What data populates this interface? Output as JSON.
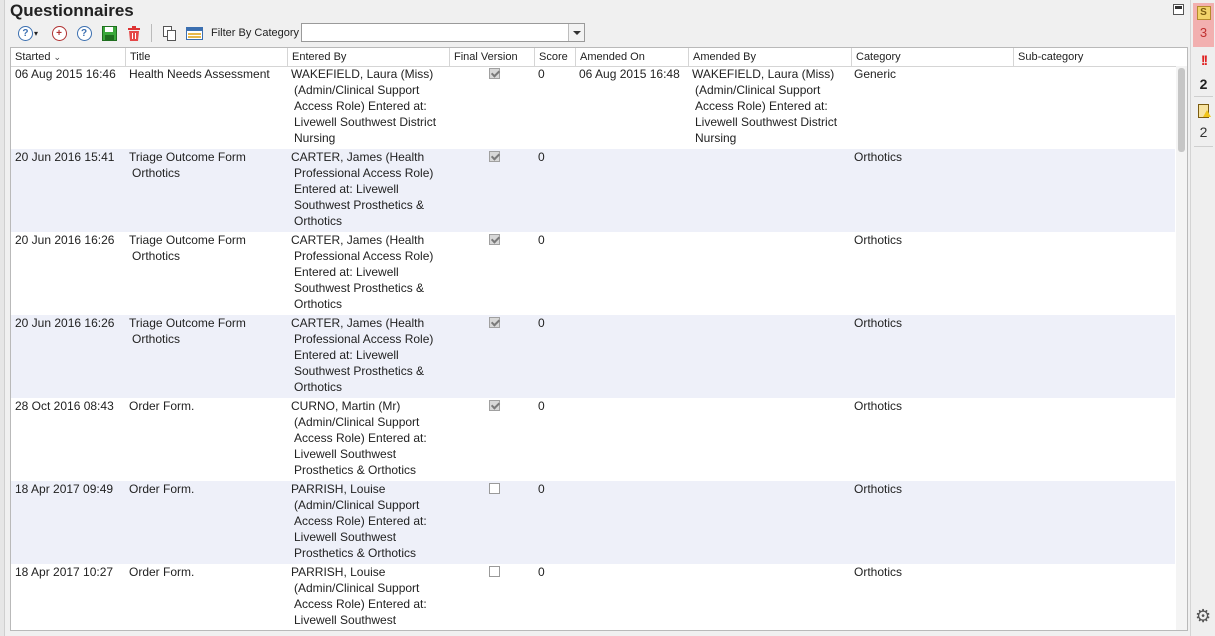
{
  "panel": {
    "title": "Questionnaires"
  },
  "toolbar": {
    "filter_label": "Filter By Category",
    "filter_value": "",
    "icons": [
      "help-dropdown-icon",
      "add-questionnaire-icon",
      "help-icon",
      "save-icon",
      "delete-icon",
      "copy-icon",
      "category-table-icon"
    ]
  },
  "colors": {
    "row_alt": "#eef0f9",
    "alert_bg": "#f2b0b0",
    "alert_red": "#e02020"
  },
  "columns": [
    {
      "label": "Started",
      "sorted": true
    },
    {
      "label": "Title"
    },
    {
      "label": "Entered By"
    },
    {
      "label": "Final Version"
    },
    {
      "label": "Score"
    },
    {
      "label": "Amended On"
    },
    {
      "label": "Amended By"
    },
    {
      "label": "Category"
    },
    {
      "label": "Sub-category"
    }
  ],
  "rows": [
    {
      "started": "06 Aug 2015 16:46",
      "title": [
        "Health Needs Assessment"
      ],
      "entered_by": [
        "WAKEFIELD, Laura (Miss)",
        "(Admin/Clinical Support",
        "Access Role) Entered at:",
        "Livewell Southwest District",
        "Nursing"
      ],
      "final": true,
      "score": "0",
      "amended_on": "06 Aug 2015 16:48",
      "amended_by": [
        "WAKEFIELD, Laura (Miss)",
        "(Admin/Clinical Support",
        "Access Role) Entered at:",
        "Livewell Southwest District",
        "Nursing"
      ],
      "category": "Generic",
      "subcategory": ""
    },
    {
      "started": "20 Jun 2016 15:41",
      "title": [
        "Triage Outcome Form",
        "Orthotics"
      ],
      "entered_by": [
        "CARTER, James (Health",
        "Professional Access Role)",
        "Entered at: Livewell",
        "Southwest Prosthetics &",
        "Orthotics"
      ],
      "final": true,
      "score": "0",
      "amended_on": "",
      "amended_by": [],
      "category": "Orthotics",
      "subcategory": ""
    },
    {
      "started": "20 Jun 2016 16:26",
      "title": [
        "Triage Outcome Form",
        "Orthotics"
      ],
      "entered_by": [
        "CARTER, James (Health",
        "Professional Access Role)",
        "Entered at: Livewell",
        "Southwest Prosthetics &",
        "Orthotics"
      ],
      "final": true,
      "score": "0",
      "amended_on": "",
      "amended_by": [],
      "category": "Orthotics",
      "subcategory": ""
    },
    {
      "started": "20 Jun 2016 16:26",
      "title": [
        "Triage Outcome Form",
        "Orthotics"
      ],
      "entered_by": [
        "CARTER, James (Health",
        "Professional Access Role)",
        "Entered at: Livewell",
        "Southwest Prosthetics &",
        "Orthotics"
      ],
      "final": true,
      "score": "0",
      "amended_on": "",
      "amended_by": [],
      "category": "Orthotics",
      "subcategory": ""
    },
    {
      "started": "28 Oct 2016 08:43",
      "title": [
        "Order Form."
      ],
      "entered_by": [
        "CURNO, Martin (Mr)",
        "(Admin/Clinical Support",
        "Access Role) Entered at:",
        "Livewell Southwest",
        "Prosthetics & Orthotics"
      ],
      "final": true,
      "score": "0",
      "amended_on": "",
      "amended_by": [],
      "category": "Orthotics",
      "subcategory": ""
    },
    {
      "started": "18 Apr 2017 09:49",
      "title": [
        "Order Form."
      ],
      "entered_by": [
        "PARRISH, Louise",
        "(Admin/Clinical Support",
        "Access Role) Entered at:",
        "Livewell Southwest",
        "Prosthetics & Orthotics"
      ],
      "final": false,
      "score": "0",
      "amended_on": "",
      "amended_by": [],
      "category": "Orthotics",
      "subcategory": ""
    },
    {
      "started": "18 Apr 2017 10:27",
      "title": [
        "Order Form."
      ],
      "entered_by": [
        "PARRISH, Louise",
        "(Admin/Clinical Support",
        "Access Role) Entered at:",
        "Livewell Southwest"
      ],
      "final": false,
      "score": "0",
      "amended_on": "",
      "amended_by": [],
      "category": "Orthotics",
      "subcategory": ""
    }
  ],
  "sidebar": {
    "alert_count": "3",
    "warning_count": "2",
    "document_count": "2"
  }
}
